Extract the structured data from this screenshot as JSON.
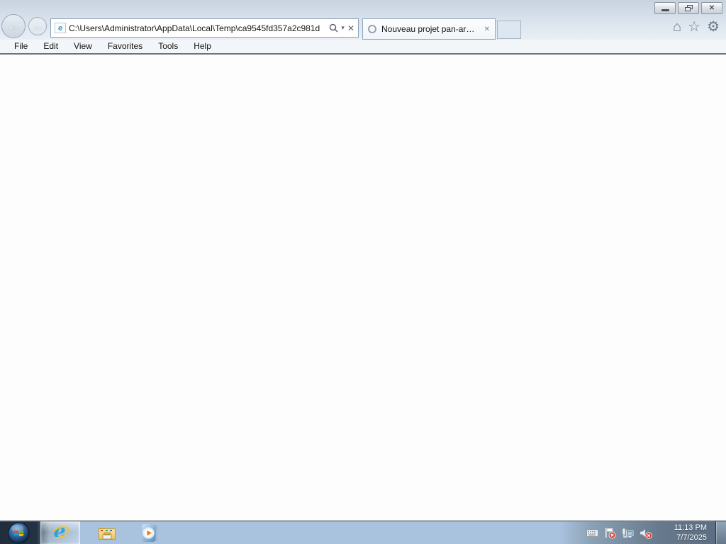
{
  "window": {
    "glyphs": {
      "close": "✕"
    }
  },
  "browser": {
    "nav": {
      "back_glyph": "←",
      "forward_glyph": "→"
    },
    "address_bar": {
      "url": "C:\\Users\\Administrator\\AppData\\Local\\Temp\\ca9545fd357a2c981d",
      "favicon_glyph": "e",
      "dropdown_glyph": "▾",
      "stop_glyph": "✕"
    },
    "tab": {
      "title": "Nouveau projet pan-armén...",
      "state": "loading",
      "close_glyph": "✕"
    },
    "toolbar": {
      "home_glyph": "⌂",
      "favorites_glyph": "☆",
      "tools_glyph": "⚙"
    },
    "menu": [
      {
        "label": "File"
      },
      {
        "label": "Edit"
      },
      {
        "label": "View"
      },
      {
        "label": "Favorites"
      },
      {
        "label": "Tools"
      },
      {
        "label": "Help"
      }
    ]
  },
  "page": {
    "content": ""
  },
  "taskbar": {
    "apps": [
      {
        "name": "internet-explorer",
        "active": true
      },
      {
        "name": "windows-explorer",
        "active": false
      },
      {
        "name": "media-player",
        "active": false
      }
    ],
    "tray_icons": [
      "keyboard",
      "action-center-alert",
      "network",
      "volume-muted"
    ],
    "clock": {
      "time": "11:13 PM",
      "date": "7/7/2025"
    }
  },
  "colors": {
    "chrome_top": "#c7d3e0",
    "chrome_bottom": "#e9eff5",
    "taskbar_blue": "#a9c2de",
    "separator": "#6f7276",
    "ie_blue": "#27a5dd",
    "alert_red": "#d63a2f"
  }
}
